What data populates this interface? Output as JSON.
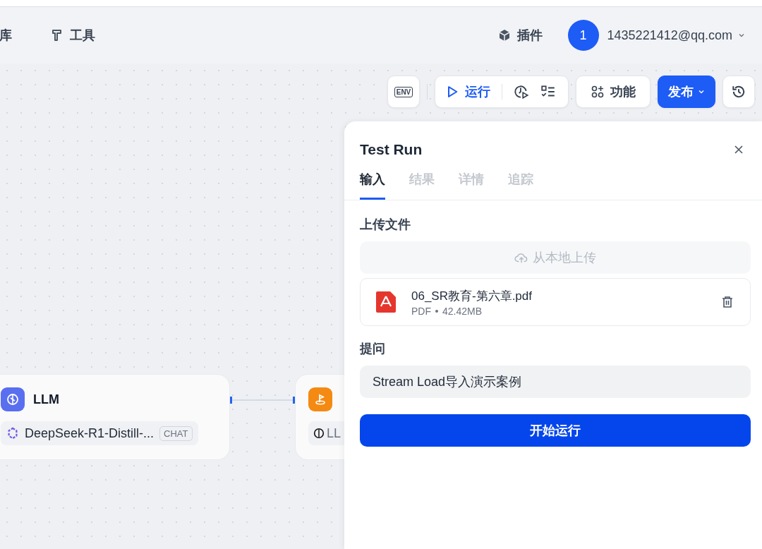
{
  "header": {
    "nav": [
      {
        "label": "库",
        "kind": "text"
      },
      {
        "label": "工具",
        "kind": "tool"
      }
    ],
    "plugin": "插件",
    "avatar": "1",
    "account": "1435221412@qq.com"
  },
  "toolbar": {
    "env": "ENV",
    "run": "运行",
    "features": "功能",
    "publish": "发布"
  },
  "nodes": [
    {
      "kind": "llm",
      "title": "LLM",
      "model": "DeepSeek-R1-Distill-...",
      "tag": "CHAT"
    },
    {
      "kind": "end",
      "model": "LL"
    }
  ],
  "panel": {
    "title": "Test Run",
    "tabs": [
      {
        "label": "输入",
        "selected": true
      },
      {
        "label": "结果",
        "selected": false
      },
      {
        "label": "详情",
        "selected": false
      },
      {
        "label": "追踪",
        "selected": false
      }
    ],
    "upload_label": "上传文件",
    "upload_button": "从本地上传",
    "file": {
      "name": "06_SR教育-第六章.pdf",
      "type": "PDF",
      "size": "42.42MB"
    },
    "question_label": "提问",
    "question": "Stream Load导入演示案例",
    "start": "开始运行"
  }
}
